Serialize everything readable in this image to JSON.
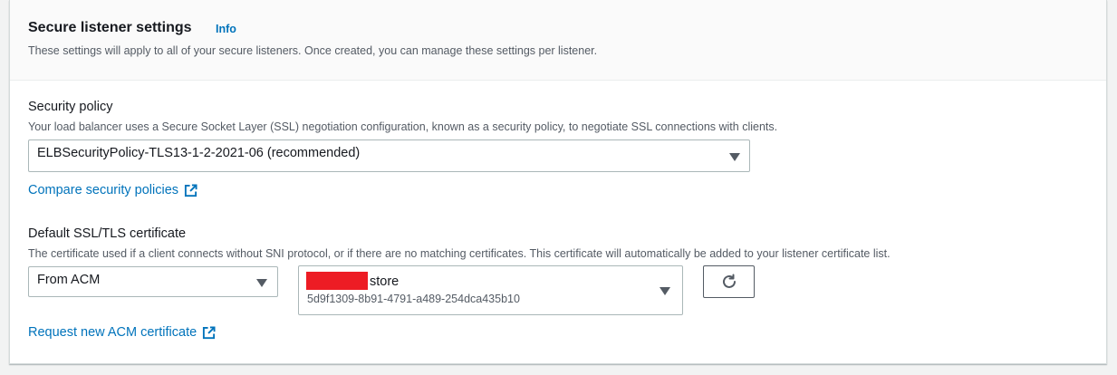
{
  "header": {
    "title": "Secure listener settings",
    "info_label": "Info",
    "description": "These settings will apply to all of your secure listeners. Once created, you can manage these settings per listener."
  },
  "security_policy": {
    "label": "Security policy",
    "description": "Your load balancer uses a Secure Socket Layer (SSL) negotiation configuration, known as a security policy, to negotiate SSL connections with clients.",
    "selected": "ELBSecurityPolicy-TLS13-1-2-2021-06 (recommended)",
    "compare_link": "Compare security policies"
  },
  "certificate": {
    "label": "Default SSL/TLS certificate",
    "description": "The certificate used if a client connects without SNI protocol, or if there are no matching certificates. This certificate will automatically be added to your listener certificate list.",
    "source_selected": "From ACM",
    "cert_name_suffix": "store",
    "cert_id": "5d9f1309-8b91-4791-a489-254dca435b10",
    "request_link": "Request new ACM certificate"
  },
  "icons": {
    "external_link": "external-link-icon",
    "refresh": "refresh-icon",
    "dropdown": "caret-down-icon"
  },
  "colors": {
    "link": "#0073bb",
    "text": "#16191f",
    "secondary_text": "#545b64",
    "redaction": "#ed1c24"
  }
}
